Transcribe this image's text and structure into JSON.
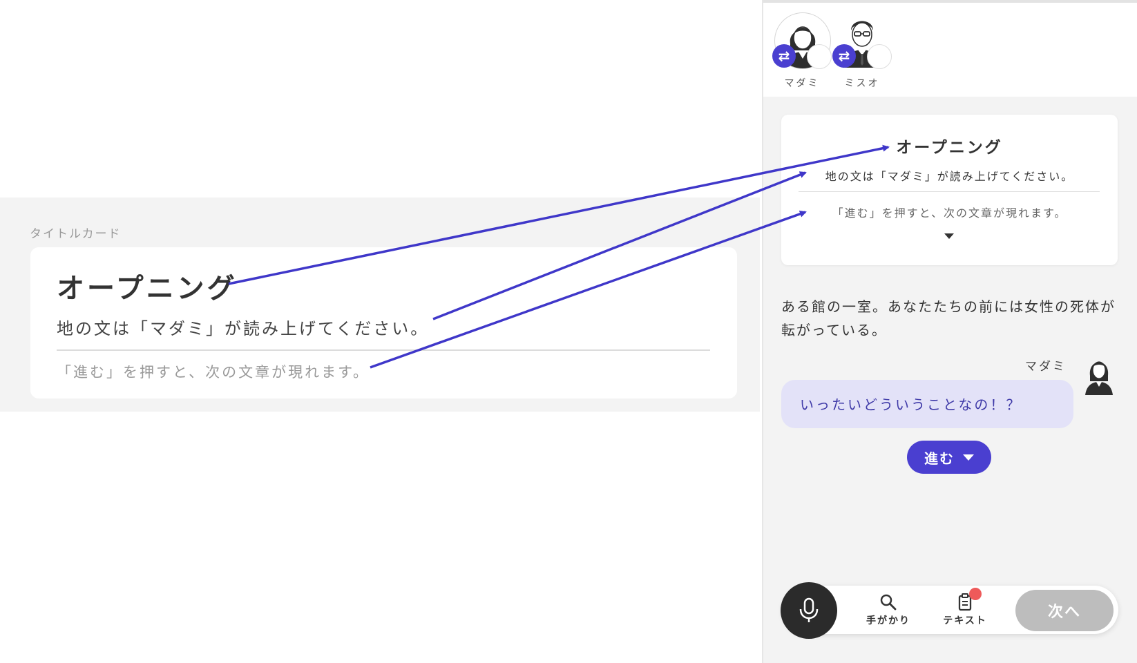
{
  "editor": {
    "section_label": "タイトルカード",
    "title": "オープニング",
    "subtitle": "地の文は「マダミ」が読み上げてください。",
    "hint": "「進む」を押すと、次の文章が現れます。"
  },
  "characters": [
    {
      "name": "マダミ",
      "icon": "woman-avatar-icon"
    },
    {
      "name": "ミスオ",
      "icon": "man-glasses-avatar-icon"
    }
  ],
  "title_card": {
    "title": "オープニング",
    "subtitle": "地の文は「マダミ」が読み上げてください。",
    "hint": "「進む」を押すと、次の文章が現れます。"
  },
  "narration": "ある館の一室。あなたたちの前には女性の死体が転がっている。",
  "dialogue": {
    "speaker": "マダミ",
    "text": "いったいどういうことなの！？"
  },
  "advance_button": "進む",
  "bottom_bar": {
    "clues_label": "手がかり",
    "text_label": "テキスト",
    "next_label": "次へ"
  },
  "colors": {
    "accent": "#4a3fd0",
    "bubble": "#e3e2f8",
    "notification": "#ee5a5a",
    "disabled": "#bdbdbd"
  }
}
